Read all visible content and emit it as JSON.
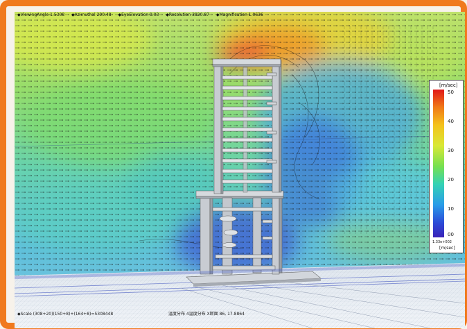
{
  "status_top": [
    "◆ViewingAngle 1.5308",
    "◆Azimuthal 290.48",
    "◆EyeElevation 9.03",
    "◆Resolution 3820.87",
    "◆Magnification 1.0636"
  ],
  "status_bottom": {
    "left": "◆Scale  (308+20)(150+8)+(164+8)=5308448",
    "center": "温度分布  4温度分布 X断面  86, 17.8864"
  },
  "legend": {
    "unit": "[m/sec]",
    "ticks": [
      "50",
      "40",
      "30",
      "20",
      "10",
      "00"
    ],
    "max_label": "1.33e+002",
    "unit_bottom": "[m/sec]",
    "colors": [
      "#e01818",
      "#f07a18",
      "#f4c21c",
      "#d9e836",
      "#76e050",
      "#34d2b4",
      "#2a9ce8",
      "#2c4cd8",
      "#3a22b8"
    ]
  },
  "colors": {
    "frame": "#f07a1e",
    "floor": "#e6ebf2",
    "building": "#c8ccd2"
  }
}
